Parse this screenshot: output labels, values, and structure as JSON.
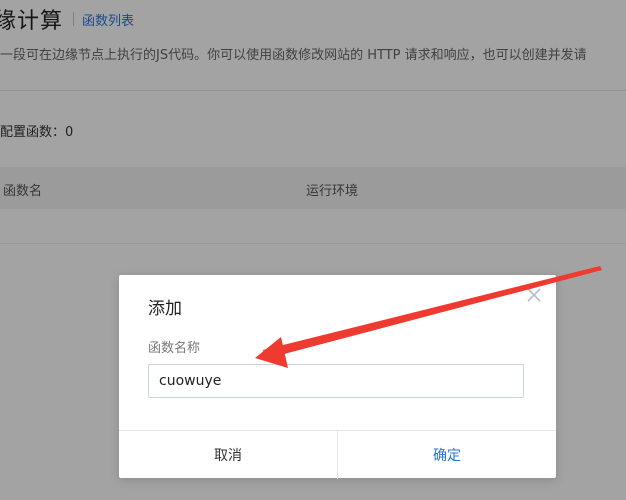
{
  "page": {
    "title": "缘计算",
    "breadcrumb_link": "函数列表",
    "description": "一段可在边缘节点上执行的JS代码。你可以使用函数修改网站的 HTTP 请求和响应，也可以创建并发请",
    "configured_count_label": "配置函数：0"
  },
  "table": {
    "columns": [
      "函数名",
      "运行环境"
    ]
  },
  "modal": {
    "title": "添加",
    "field_label": "函数名称",
    "input_value": "cuowuye",
    "cancel_label": "取消",
    "confirm_label": "确定"
  },
  "colors": {
    "accent": "#2a73d9",
    "annotation_arrow": "#ee3a2f"
  },
  "icons": {
    "close": "close-icon"
  }
}
